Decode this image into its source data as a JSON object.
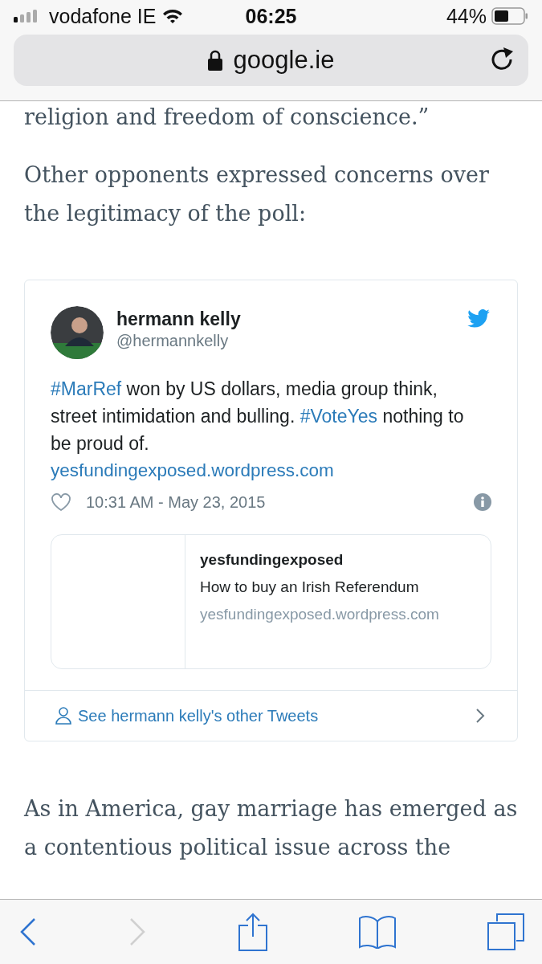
{
  "status_bar": {
    "carrier": "vodafone IE",
    "time": "06:25",
    "battery": "44%"
  },
  "address_bar": {
    "url": "google.ie"
  },
  "article": [
    {
      "kind": "paragraph",
      "text": "religion and freedom of conscience.”"
    },
    {
      "kind": "paragraph",
      "text": "Other opponents expressed concerns over the legitimacy of the poll:"
    },
    {
      "kind": "tweet",
      "author": "hermann kelly",
      "handle": "@hermannkelly",
      "segments": [
        {
          "kind": "hashtag",
          "text": "#MarRef"
        },
        {
          "kind": "plain",
          "text": " won by US dollars, media group think, street intimidation and bulling. "
        },
        {
          "kind": "hashtag",
          "text": "#VoteYes"
        },
        {
          "kind": "plain",
          "text": " nothing to be proud of."
        }
      ],
      "link": "yesfundingexposed.wordpress.com",
      "timestamp": "10:31 AM - May 23, 2015",
      "card": {
        "site": "yesfundingexposed",
        "title": "How to buy an Irish Referendum",
        "domain": "yesfundingexposed.wordpress.com"
      },
      "footer_link": "See hermann kelly's other Tweets"
    },
    {
      "kind": "paragraph",
      "text": "As in America, gay marriage has emerged as a contentious political issue across the"
    }
  ],
  "toolbar": [
    {
      "kind": "back",
      "disabled": false
    },
    {
      "kind": "forward",
      "disabled": true
    },
    {
      "kind": "share",
      "disabled": false
    },
    {
      "kind": "bookmarks",
      "disabled": false
    },
    {
      "kind": "tabs",
      "disabled": false
    }
  ]
}
